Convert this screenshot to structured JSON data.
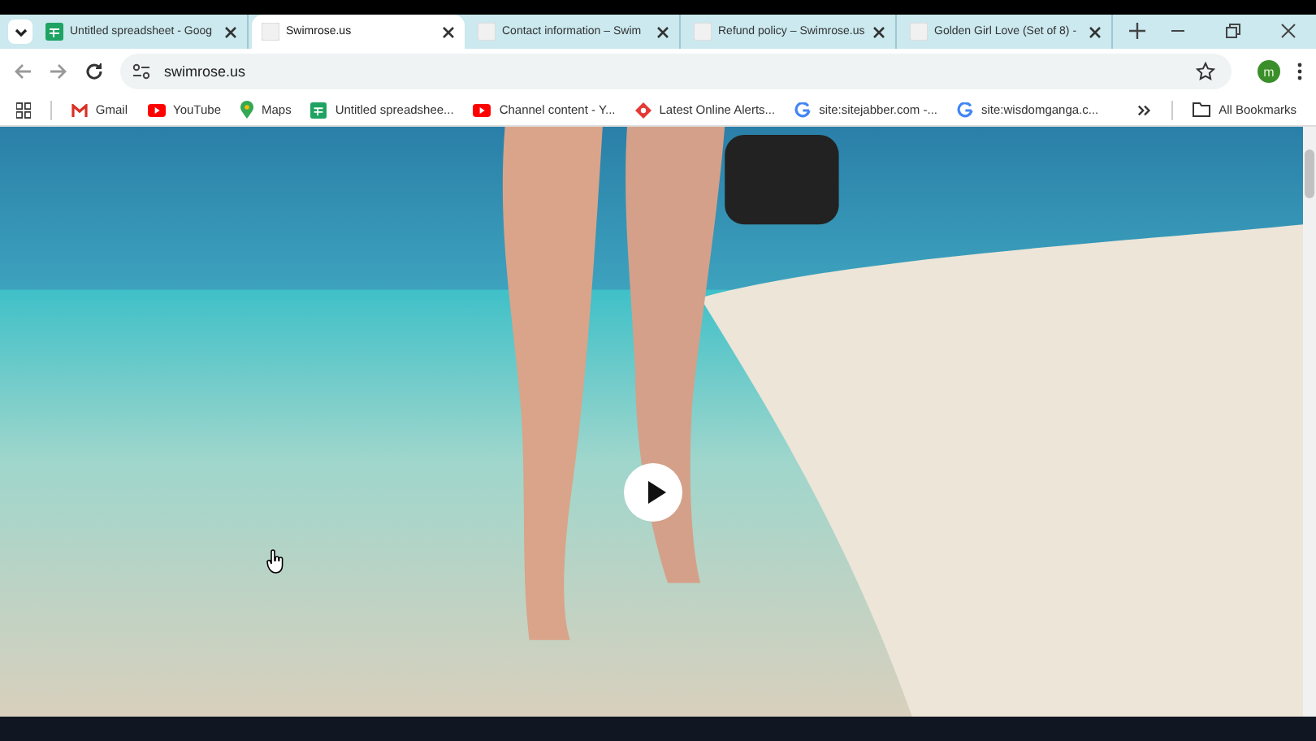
{
  "tabs": [
    {
      "label": "Untitled spreadsheet - Goog",
      "kind": "sheets",
      "selected": false
    },
    {
      "label": "Swimrose.us",
      "kind": "blank",
      "selected": true
    },
    {
      "label": "Contact information – Swim",
      "kind": "blank",
      "selected": false
    },
    {
      "label": "Refund policy – Swimrose.us",
      "kind": "blank",
      "selected": false
    },
    {
      "label": "Golden Girl Love (Set of 8) -",
      "kind": "blank",
      "selected": false
    }
  ],
  "address_bar": {
    "url": "swimrose.us"
  },
  "profile": {
    "initial": "m"
  },
  "bookmarks": [
    {
      "label": "Gmail",
      "kind": "gmail"
    },
    {
      "label": "YouTube",
      "kind": "youtube"
    },
    {
      "label": "Maps",
      "kind": "maps"
    },
    {
      "label": "Untitled spreadshee...",
      "kind": "sheets"
    },
    {
      "label": "Channel content - Y...",
      "kind": "youtube"
    },
    {
      "label": "Latest Online Alerts...",
      "kind": "alert"
    },
    {
      "label": "site:sitejabber.com -...",
      "kind": "google"
    },
    {
      "label": "site:wisdomganga.c...",
      "kind": "google"
    }
  ],
  "all_bookmarks": "All Bookmarks"
}
